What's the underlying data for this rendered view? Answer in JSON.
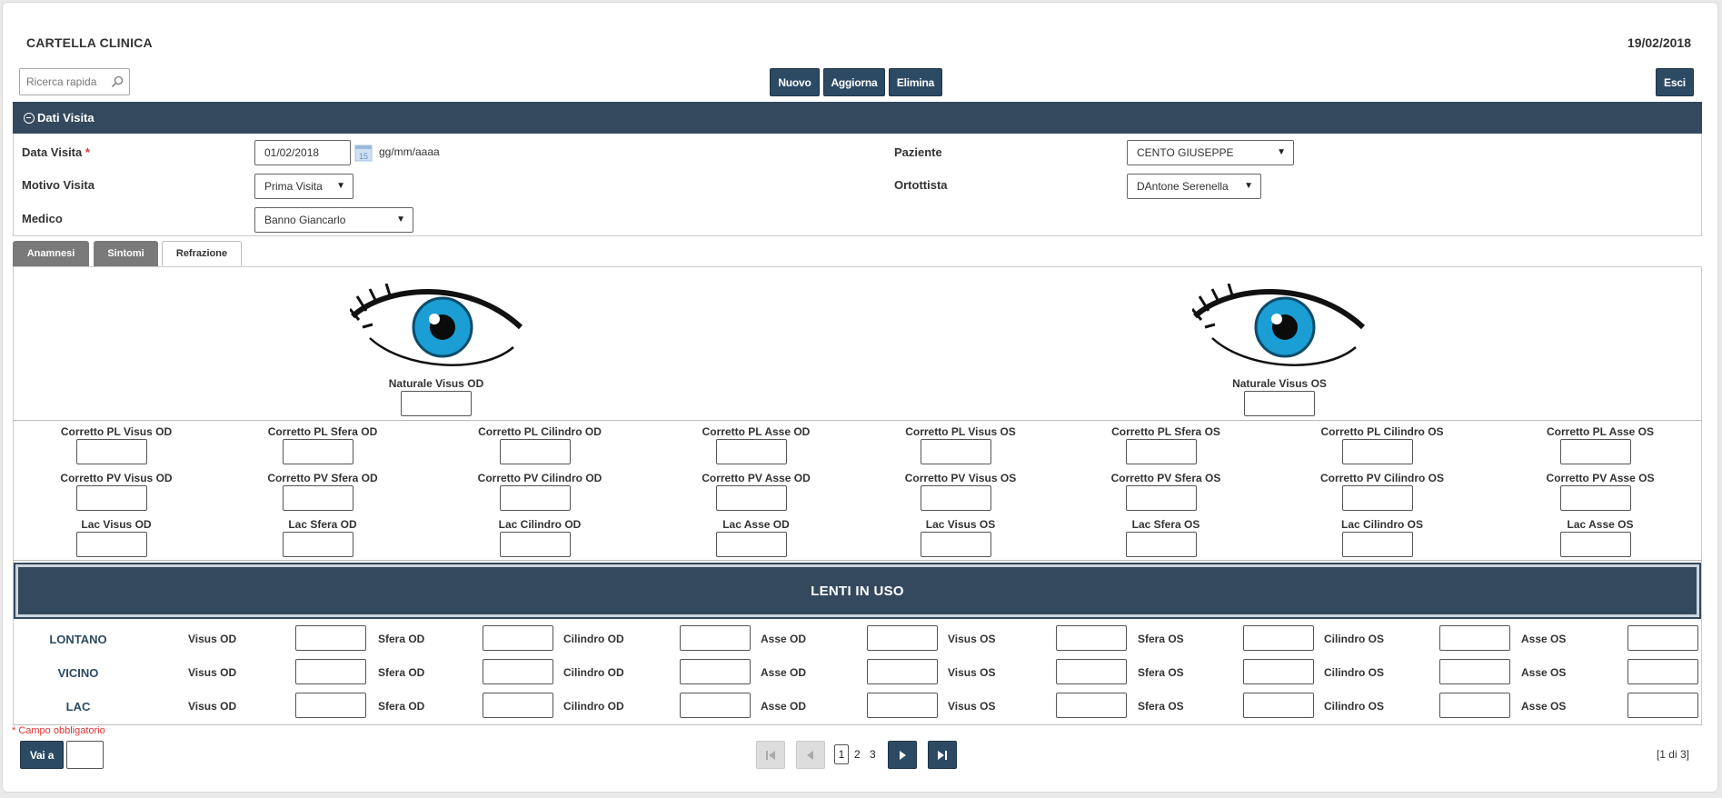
{
  "header": {
    "title": "CARTELLA CLINICA",
    "date": "19/02/2018"
  },
  "search": {
    "placeholder": "Ricerca rapida"
  },
  "toolbar": {
    "nuovo": "Nuovo",
    "aggiorna": "Aggiorna",
    "elimina": "Elimina",
    "esci": "Esci"
  },
  "section": {
    "title": "Dati Visita"
  },
  "form": {
    "data_visita_label": "Data Visita",
    "required_mark": "*",
    "data_visita_value": "01/02/2018",
    "date_hint": "gg/mm/aaaa",
    "motivo_label": "Motivo Visita",
    "motivo_value": "Prima Visita",
    "medico_label": "Medico",
    "medico_value": "Banno Giancarlo",
    "paziente_label": "Paziente",
    "paziente_value": "CENTO GIUSEPPE",
    "ortottista_label": "Ortottista",
    "ortottista_value": "DAntone Serenella"
  },
  "tabs": [
    "Anamnesi",
    "Sintomi",
    "Refrazione"
  ],
  "refrazione": {
    "naturale_od": "Naturale Visus OD",
    "naturale_os": "Naturale Visus OS",
    "rows": [
      [
        "Corretto PL Visus OD",
        "Corretto PL Sfera OD",
        "Corretto PL Cilindro OD",
        "Corretto PL Asse OD",
        "Corretto PL Visus OS",
        "Corretto PL Sfera OS",
        "Corretto PL Cilindro OS",
        "Corretto PL Asse OS"
      ],
      [
        "Corretto PV Visus OD",
        "Corretto PV Sfera OD",
        "Corretto PV Cilindro OD",
        "Corretto PV Asse OD",
        "Corretto PV Visus OS",
        "Corretto PV Sfera OS",
        "Corretto PV Cilindro OS",
        "Corretto PV Asse OS"
      ],
      [
        "Lac Visus OD",
        "Lac Sfera OD",
        "Lac Cilindro OD",
        "Lac Asse OD",
        "Lac Visus OS",
        "Lac Sfera OS",
        "Lac Cilindro OS",
        "Lac Asse OS"
      ]
    ]
  },
  "lenti": {
    "title": "LENTI IN USO",
    "rows": [
      "LONTANO",
      "VICINO",
      "LAC"
    ],
    "columns": [
      "Visus OD",
      "Sfera OD",
      "Cilindro OD",
      "Asse OD",
      "Visus OS",
      "Sfera OS",
      "Cilindro OS",
      "Asse OS"
    ]
  },
  "footer": {
    "mandatory_note": "* Campo obbligatorio",
    "vai_a": "Vai a",
    "pages": [
      "1",
      "2",
      "3"
    ],
    "page_info": "[1 di 3]"
  },
  "colors": {
    "primary": "#34495e",
    "button": "#2d4a64",
    "required": "#dd3333",
    "iris": "#1a9ed3"
  }
}
